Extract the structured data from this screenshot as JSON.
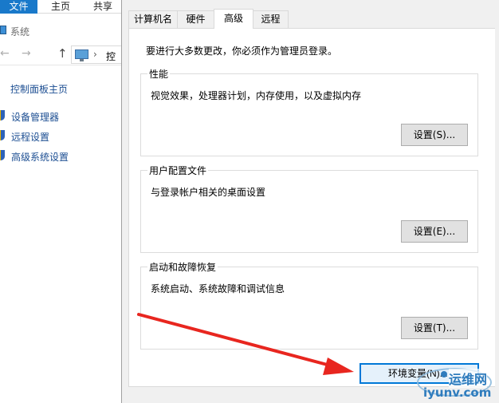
{
  "explorer": {
    "ribbon_tabs": {
      "file": "文件",
      "home": "主页",
      "share": "共享"
    },
    "window_title": "系统",
    "address_crumb": "控",
    "sidebar": {
      "home_link": "控制面板主页",
      "links": [
        "设备管理器",
        "远程设置",
        "高级系统设置"
      ]
    }
  },
  "dialog": {
    "tabs": [
      "计算机名",
      "硬件",
      "高级",
      "远程"
    ],
    "active_tab": "高级",
    "admin_note": "要进行大多数更改，你必须作为管理员登录。",
    "groups": {
      "performance": {
        "title": "性能",
        "desc": "视觉效果，处理器计划，内存使用，以及虚拟内存",
        "button": "设置(S)..."
      },
      "user_profiles": {
        "title": "用户配置文件",
        "desc": "与登录帐户相关的桌面设置",
        "button": "设置(E)..."
      },
      "startup_recovery": {
        "title": "启动和故障恢复",
        "desc": "系统启动、系统故障和调试信息",
        "button": "设置(T)..."
      }
    },
    "env_button": "环境变量(N)..."
  },
  "annotation": {
    "arrow_color": "#e8261f"
  },
  "watermark": {
    "cn": "运维网",
    "en": "iyunv.com"
  }
}
